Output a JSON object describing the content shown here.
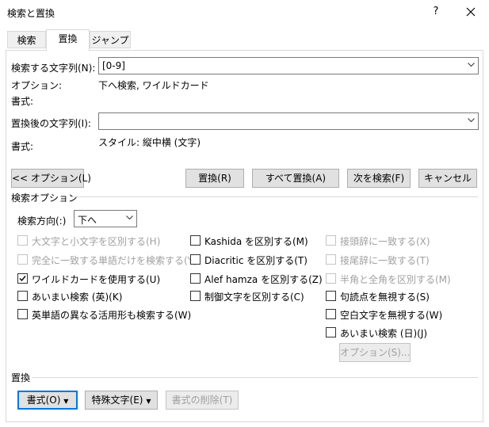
{
  "window": {
    "title": "検索と置換",
    "help_label": "?",
    "close_label": "✕"
  },
  "tabs": [
    {
      "label": "検索"
    },
    {
      "label": "置換"
    },
    {
      "label": "ジャンプ"
    }
  ],
  "find": {
    "label": "検索する文字列(N):",
    "value": "[0-9]",
    "options_label": "オプション:",
    "options_value": "下へ検索, ワイルドカード",
    "format_label": "書式:",
    "format_value": ""
  },
  "replace": {
    "label": "置換後の文字列(I):",
    "value": "",
    "format_label": "書式:",
    "format_value": "スタイル: 縦中横 (文字)"
  },
  "buttons": {
    "less_options": "<< オプション(L)",
    "replace": "置換(R)",
    "replace_all": "すべて置換(A)",
    "find_next": "次を検索(F)",
    "cancel": "キャンセル"
  },
  "search_options": {
    "group_label": "検索オプション",
    "direction_label": "検索方向(:)",
    "direction_value": "下へ",
    "col1": [
      {
        "label": "大文字と小文字を区別する(H)",
        "checked": false,
        "disabled": true
      },
      {
        "label": "完全に一致する単語だけを検索する(Y)",
        "checked": false,
        "disabled": true
      },
      {
        "label": "ワイルドカードを使用する(U)",
        "checked": true,
        "disabled": false
      },
      {
        "label": "あいまい検索 (英)(K)",
        "checked": false,
        "disabled": false
      },
      {
        "label": "英単語の異なる活用形も検索する(W)",
        "checked": false,
        "disabled": false
      }
    ],
    "col2": [
      {
        "label": "Kashida を区別する(M)",
        "checked": false,
        "disabled": false
      },
      {
        "label": "Diacritic を区別する(T)",
        "checked": false,
        "disabled": false
      },
      {
        "label": "Alef hamza を区別する(Z)",
        "checked": false,
        "disabled": false
      },
      {
        "label": "制御文字を区別する(C)",
        "checked": false,
        "disabled": false
      }
    ],
    "col3": [
      {
        "label": "接頭辞に一致する(X)",
        "checked": false,
        "disabled": true
      },
      {
        "label": "接尾辞に一致する(T)",
        "checked": false,
        "disabled": true
      },
      {
        "label": "半角と全角を区別する(M)",
        "checked": false,
        "disabled": true
      },
      {
        "label": "句読点を無視する(S)",
        "checked": false,
        "disabled": false
      },
      {
        "label": "空白文字を無視する(W)",
        "checked": false,
        "disabled": false
      },
      {
        "label": "あいまい検索 (日)(J)",
        "checked": false,
        "disabled": false
      }
    ],
    "fuzzy_options_button": "オプション(S)..."
  },
  "replace_group": {
    "group_label": "置換",
    "format_button": "書式(O)",
    "special_button": "特殊文字(E)",
    "clear_format_button": "書式の削除(T)"
  }
}
